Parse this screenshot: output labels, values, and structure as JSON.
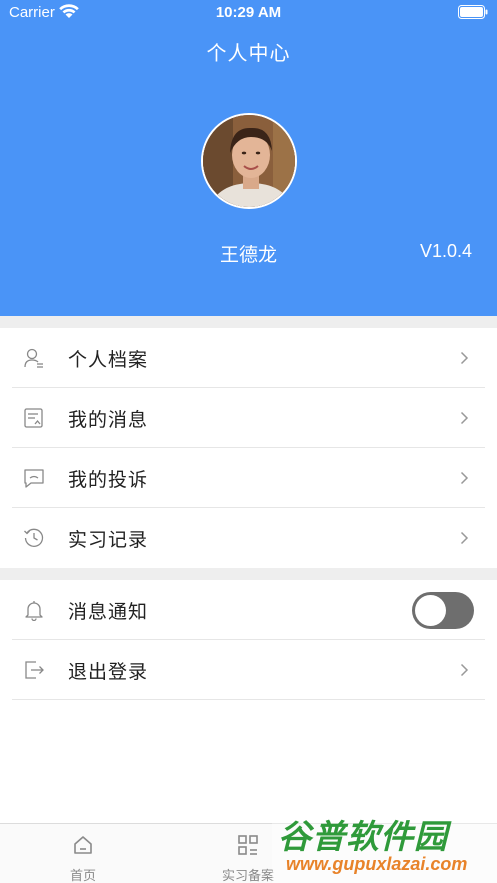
{
  "status_bar": {
    "carrier": "Carrier",
    "time": "10:29 AM"
  },
  "header": {
    "title": "个人中心",
    "user_name": "王德龙",
    "version": "V1.0.4"
  },
  "menu_group_1": [
    {
      "label": "个人档案",
      "icon": "user-profile-icon"
    },
    {
      "label": "我的消息",
      "icon": "message-icon"
    },
    {
      "label": "我的投诉",
      "icon": "complaint-icon"
    },
    {
      "label": "实习记录",
      "icon": "history-icon"
    }
  ],
  "menu_group_2": {
    "notification": {
      "label": "消息通知",
      "icon": "bell-icon",
      "toggle_on": false
    },
    "logout": {
      "label": "退出登录",
      "icon": "logout-icon"
    }
  },
  "tab_bar": [
    {
      "label": "首页",
      "icon": "home-icon"
    },
    {
      "label": "实习备案",
      "icon": "grid-icon"
    }
  ],
  "watermark": {
    "logo": "谷普软件园",
    "url": "www.gupuxlazai.com"
  },
  "colors": {
    "header_bg": "#4a94f7",
    "toggle_off": "#6e6e6e",
    "separator": "#eeeeee"
  }
}
